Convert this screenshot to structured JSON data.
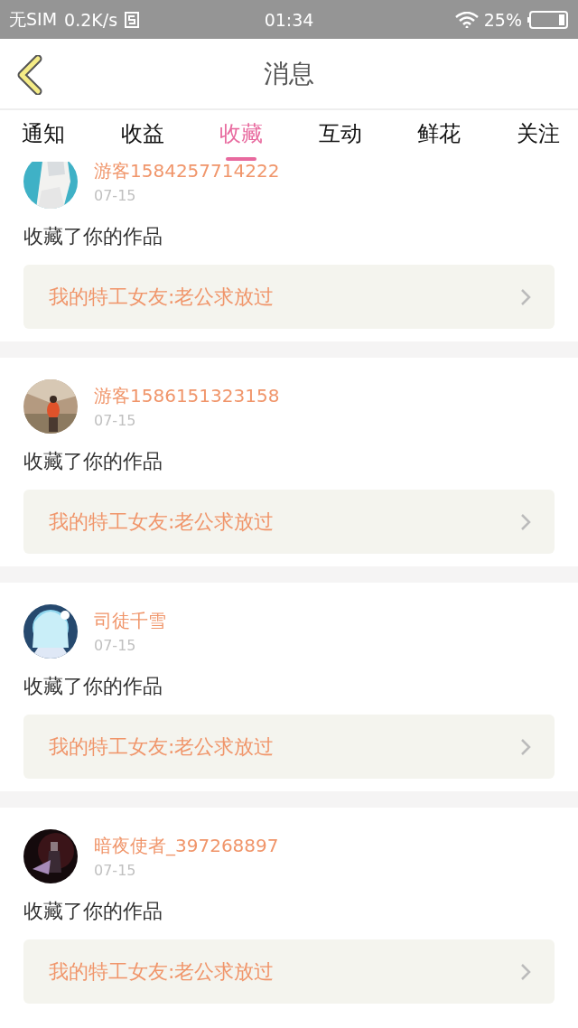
{
  "status_bar": {
    "carrier": "无SIM",
    "speed": "0.2K/s",
    "time": "01:34",
    "battery": "25%"
  },
  "header": {
    "title": "消息"
  },
  "tabs": [
    {
      "label": "通知",
      "selected": false
    },
    {
      "label": "收益",
      "selected": false
    },
    {
      "label": "收藏",
      "selected": true
    },
    {
      "label": "互动",
      "selected": false
    },
    {
      "label": "鲜花",
      "selected": false
    },
    {
      "label": "关注",
      "selected": false
    }
  ],
  "messages": [
    {
      "user": "游客1584257714222",
      "date": "07-15",
      "action": "收藏了你的作品",
      "work": "我的特工女友:老公求放过"
    },
    {
      "user": "游客1586151323158",
      "date": "07-15",
      "action": "收藏了你的作品",
      "work": "我的特工女友:老公求放过"
    },
    {
      "user": "司徒千雪",
      "date": "07-15",
      "action": "收藏了你的作品",
      "work": "我的特工女友:老公求放过"
    },
    {
      "user": "暗夜使者_397268897",
      "date": "07-15",
      "action": "收藏了你的作品",
      "work": "我的特工女友:老公求放过"
    }
  ]
}
